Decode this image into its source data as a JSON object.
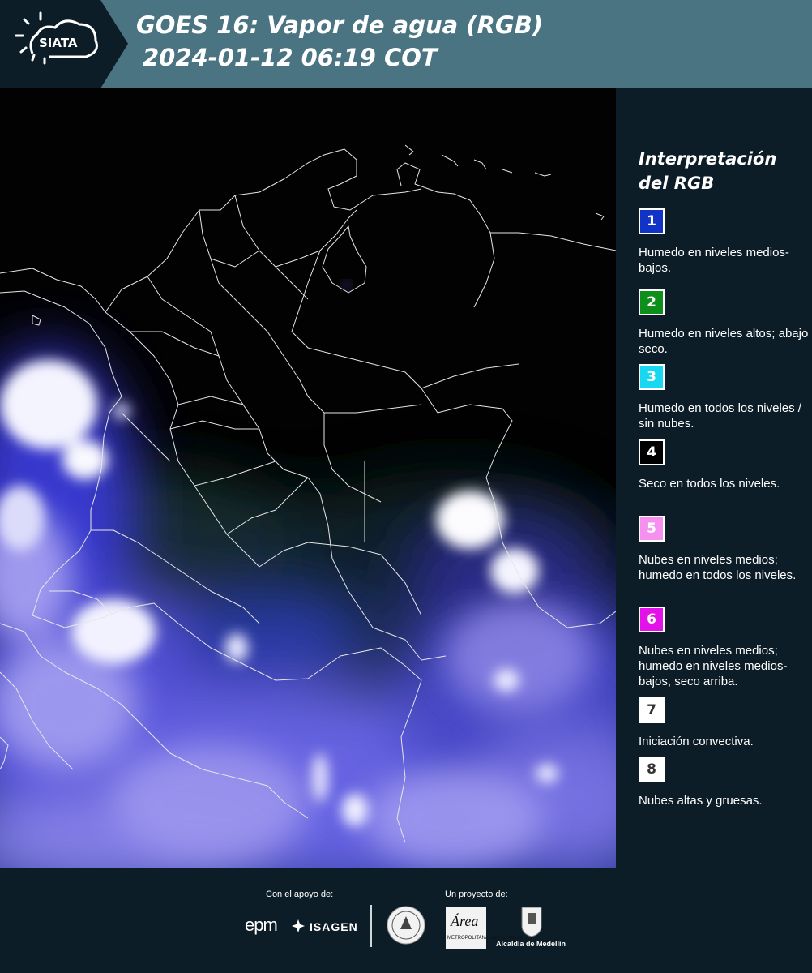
{
  "header": {
    "logo_text": "SIATA",
    "title_line1": "GOES 16: Vapor de agua (RGB)",
    "title_line2": "2024-01-12 06:19 COT"
  },
  "map": {
    "background_color": "#020203",
    "border_color": "#e6e6e6"
  },
  "legend": {
    "title": "Interpretación del RGB",
    "items": [
      {
        "number": "1",
        "color": "#1233c8",
        "number_color": "#ffffff",
        "text": "Humedo en niveles medios-bajos."
      },
      {
        "number": "2",
        "color": "#0e8f1a",
        "number_color": "#ffffff",
        "text": "Humedo en niveles altos; abajo seco."
      },
      {
        "number": "3",
        "color": "#17d8f0",
        "number_color": "#ffffff",
        "text": "Humedo en todos los niveles / sin nubes."
      },
      {
        "number": "4",
        "color": "#000000",
        "number_color": "#ffffff",
        "text": "Seco en todos los niveles."
      },
      {
        "number": "5",
        "color": "#f590ee",
        "number_color": "#ffffff",
        "text": "Nubes en niveles medios; humedo en todos los niveles."
      },
      {
        "number": "6",
        "color": "#e312e8",
        "number_color": "#ffffff",
        "text": "Nubes en niveles medios; humedo en niveles medios-bajos, seco arriba."
      },
      {
        "number": "7",
        "color": "#ffffff",
        "number_color": "#333333",
        "text": "Iniciación convectiva."
      },
      {
        "number": "8",
        "color": "#ffffff",
        "number_color": "#333333",
        "text": "Nubes altas y gruesas."
      }
    ]
  },
  "footer": {
    "support_label": "Con el apoyo de:",
    "project_label": "Un proyecto de:",
    "sponsor_epm": "epm",
    "sponsor_isagen": "ISAGEN",
    "area_logo_word": "Área",
    "area_logo_sub": "METROPOLITANA Valle de Aburrá",
    "medellin_label": "Alcaldía de Medellín"
  }
}
